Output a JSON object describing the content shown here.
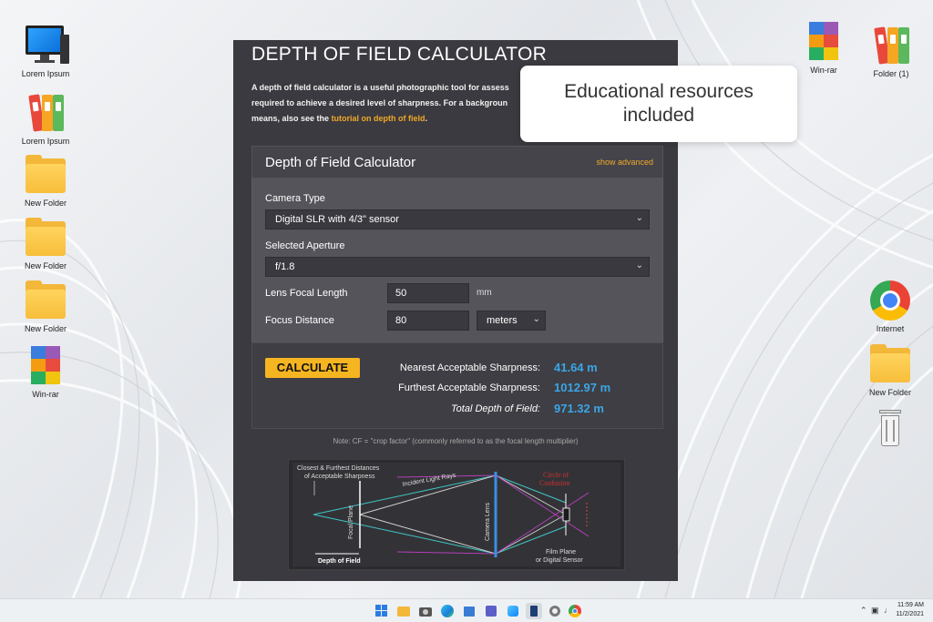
{
  "desktop_left": [
    {
      "label": "Lorem Ipsum",
      "icon": "computer-icon"
    },
    {
      "label": "Lorem Ipsum",
      "icon": "binders-icon"
    },
    {
      "label": "New Folder",
      "icon": "folder-icon"
    },
    {
      "label": "New Folder",
      "icon": "folder-icon"
    },
    {
      "label": "New Folder",
      "icon": "folder-icon"
    },
    {
      "label": "Win-rar",
      "icon": "winrar-icon"
    }
  ],
  "desktop_right": [
    {
      "label": "Win-rar",
      "icon": "winrar-icon"
    },
    {
      "label": "Folder (1)",
      "icon": "binders-icon"
    },
    {
      "label": "Internet",
      "icon": "chrome-icon"
    },
    {
      "label": "New Folder",
      "icon": "folder-icon"
    },
    {
      "label": "",
      "icon": "recycle-bin-icon"
    }
  ],
  "page": {
    "title": "DEPTH OF FIELD CALCULATOR",
    "intro_line1": "A depth of field calculator is a useful photographic tool for assess",
    "intro_line2": "required to achieve a desired level of sharpness. For a backgroun",
    "intro_line3_pre": "means, also see the",
    "intro_link": "tutorial on depth of field",
    "intro_line3_post": "."
  },
  "calculator": {
    "title": "Depth of Field Calculator",
    "advanced_link": "show advanced",
    "camera_type_label": "Camera Type",
    "camera_type_value": "Digital SLR with 4/3\" sensor",
    "aperture_label": "Selected Aperture",
    "aperture_value": "f/1.8",
    "focal_length_label": "Lens Focal Length",
    "focal_length_value": "50",
    "focal_length_unit": "mm",
    "focus_distance_label": "Focus Distance",
    "focus_distance_value": "80",
    "focus_distance_unit": "meters",
    "calculate_label": "CALCULATE",
    "nearest_label": "Nearest Acceptable Sharpness:",
    "nearest_value": "41.64 m",
    "furthest_label": "Furthest Acceptable Sharpness:",
    "furthest_value": "1012.97 m",
    "total_label": "Total Depth of Field:",
    "total_value": "971.32 m",
    "note": "Note: CF = \"crop factor\" (commonly referred to as the focal length multiplier)"
  },
  "diagram": {
    "closest_label_1": "Closest & Furthest Distances",
    "closest_label_2": "of Acceptable Sharpness",
    "incident_rays": "Incident Light Rays",
    "focal_plane": "Focal Plane",
    "camera_lens": "Camera Lens",
    "circle_conf_1": "Circle of",
    "circle_conf_2": "Confusion",
    "depth_of_field": "Depth of Field",
    "film_plane_1": "Film Plane",
    "film_plane_2": "or Digital Sensor"
  },
  "callout": {
    "line1": "Educational resources",
    "line2": "included"
  },
  "taskbar": {
    "time": "11:59 AM",
    "date": "11/2/2021"
  }
}
